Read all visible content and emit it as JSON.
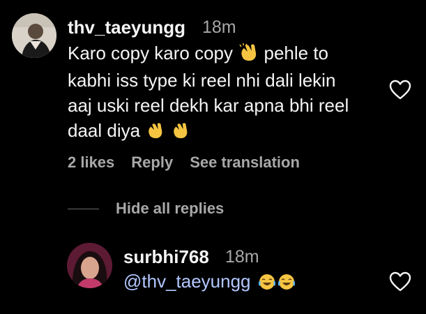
{
  "comment": {
    "avatar_icon": "user-avatar-icon",
    "username": "thv_taeyungg",
    "time": "18m",
    "text_lines": [
      "Karo copy karo copy",
      "pehle to",
      "kabhi iss type ki reel nhi dali lekin",
      "aaj uski reel dekh kar apna bhi reel",
      "daal diya"
    ],
    "likes": "2 likes",
    "reply_label": "Reply",
    "translate_label": "See translation",
    "heart_icon": "heart-outline-icon"
  },
  "replies_toggle": {
    "label": "Hide all replies"
  },
  "reply": {
    "avatar_icon": "user-avatar-icon",
    "username": "surbhi768",
    "time": "18m",
    "mention": "@thv_taeyungg",
    "heart_icon": "heart-outline-icon"
  },
  "colors": {
    "background": "#000000",
    "primary_text": "#f5f5f5",
    "secondary_text": "#a8a8a8",
    "mention": "#b3c7ff"
  }
}
